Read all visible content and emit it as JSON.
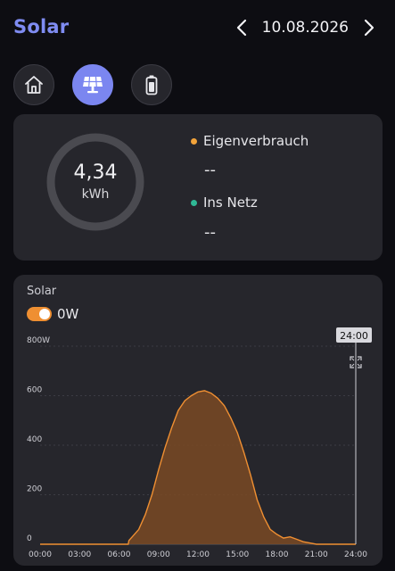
{
  "header": {
    "title": "Solar",
    "date": "10.08.2026"
  },
  "tabs": [
    {
      "name": "home",
      "icon": "home-icon",
      "active": false
    },
    {
      "name": "solar",
      "icon": "solar-panel-icon",
      "active": true
    },
    {
      "name": "battery",
      "icon": "battery-icon",
      "active": false
    }
  ],
  "summary": {
    "total_value": "4,34",
    "total_unit": "kWh",
    "self_consumption_label": "Eigenverbrauch",
    "self_consumption_value": "--",
    "grid_feed_label": "Ins Netz",
    "grid_feed_value": "--"
  },
  "chart_panel": {
    "title": "Solar",
    "toggle_label": "0W",
    "toggle_on": true,
    "cursor_label": "24:00"
  },
  "colors": {
    "accent": "#7b86f0",
    "solar": "#ef8f32",
    "self_consumption": "#f2a33a",
    "grid_feed": "#2fb895"
  },
  "chart_data": {
    "type": "area",
    "title": "Solar",
    "xlabel": "",
    "ylabel": "",
    "x_ticks": [
      "00:00",
      "03:00",
      "06:00",
      "09:00",
      "12:00",
      "15:00",
      "18:00",
      "21:00",
      "24:00"
    ],
    "y_ticks": [
      "0",
      "200",
      "400",
      "600",
      "800W"
    ],
    "xlim": [
      0,
      24
    ],
    "ylim": [
      0,
      800
    ],
    "grid": true,
    "series": [
      {
        "x": [
          0,
          6.7,
          6.75,
          7,
          7.5,
          8,
          8.5,
          9,
          9.5,
          10,
          10.5,
          11,
          11.5,
          12,
          12.5,
          13,
          13.5,
          14,
          14.5,
          15,
          15.5,
          16,
          16.5,
          17,
          17.5,
          18,
          18.5,
          19,
          19.5,
          20,
          20.5,
          21,
          21.5,
          24
        ],
        "y": [
          0,
          0,
          15,
          30,
          60,
          120,
          200,
          300,
          390,
          470,
          540,
          580,
          600,
          615,
          620,
          610,
          590,
          560,
          510,
          450,
          370,
          280,
          180,
          110,
          60,
          40,
          25,
          30,
          20,
          10,
          5,
          0,
          0,
          0
        ]
      }
    ]
  }
}
